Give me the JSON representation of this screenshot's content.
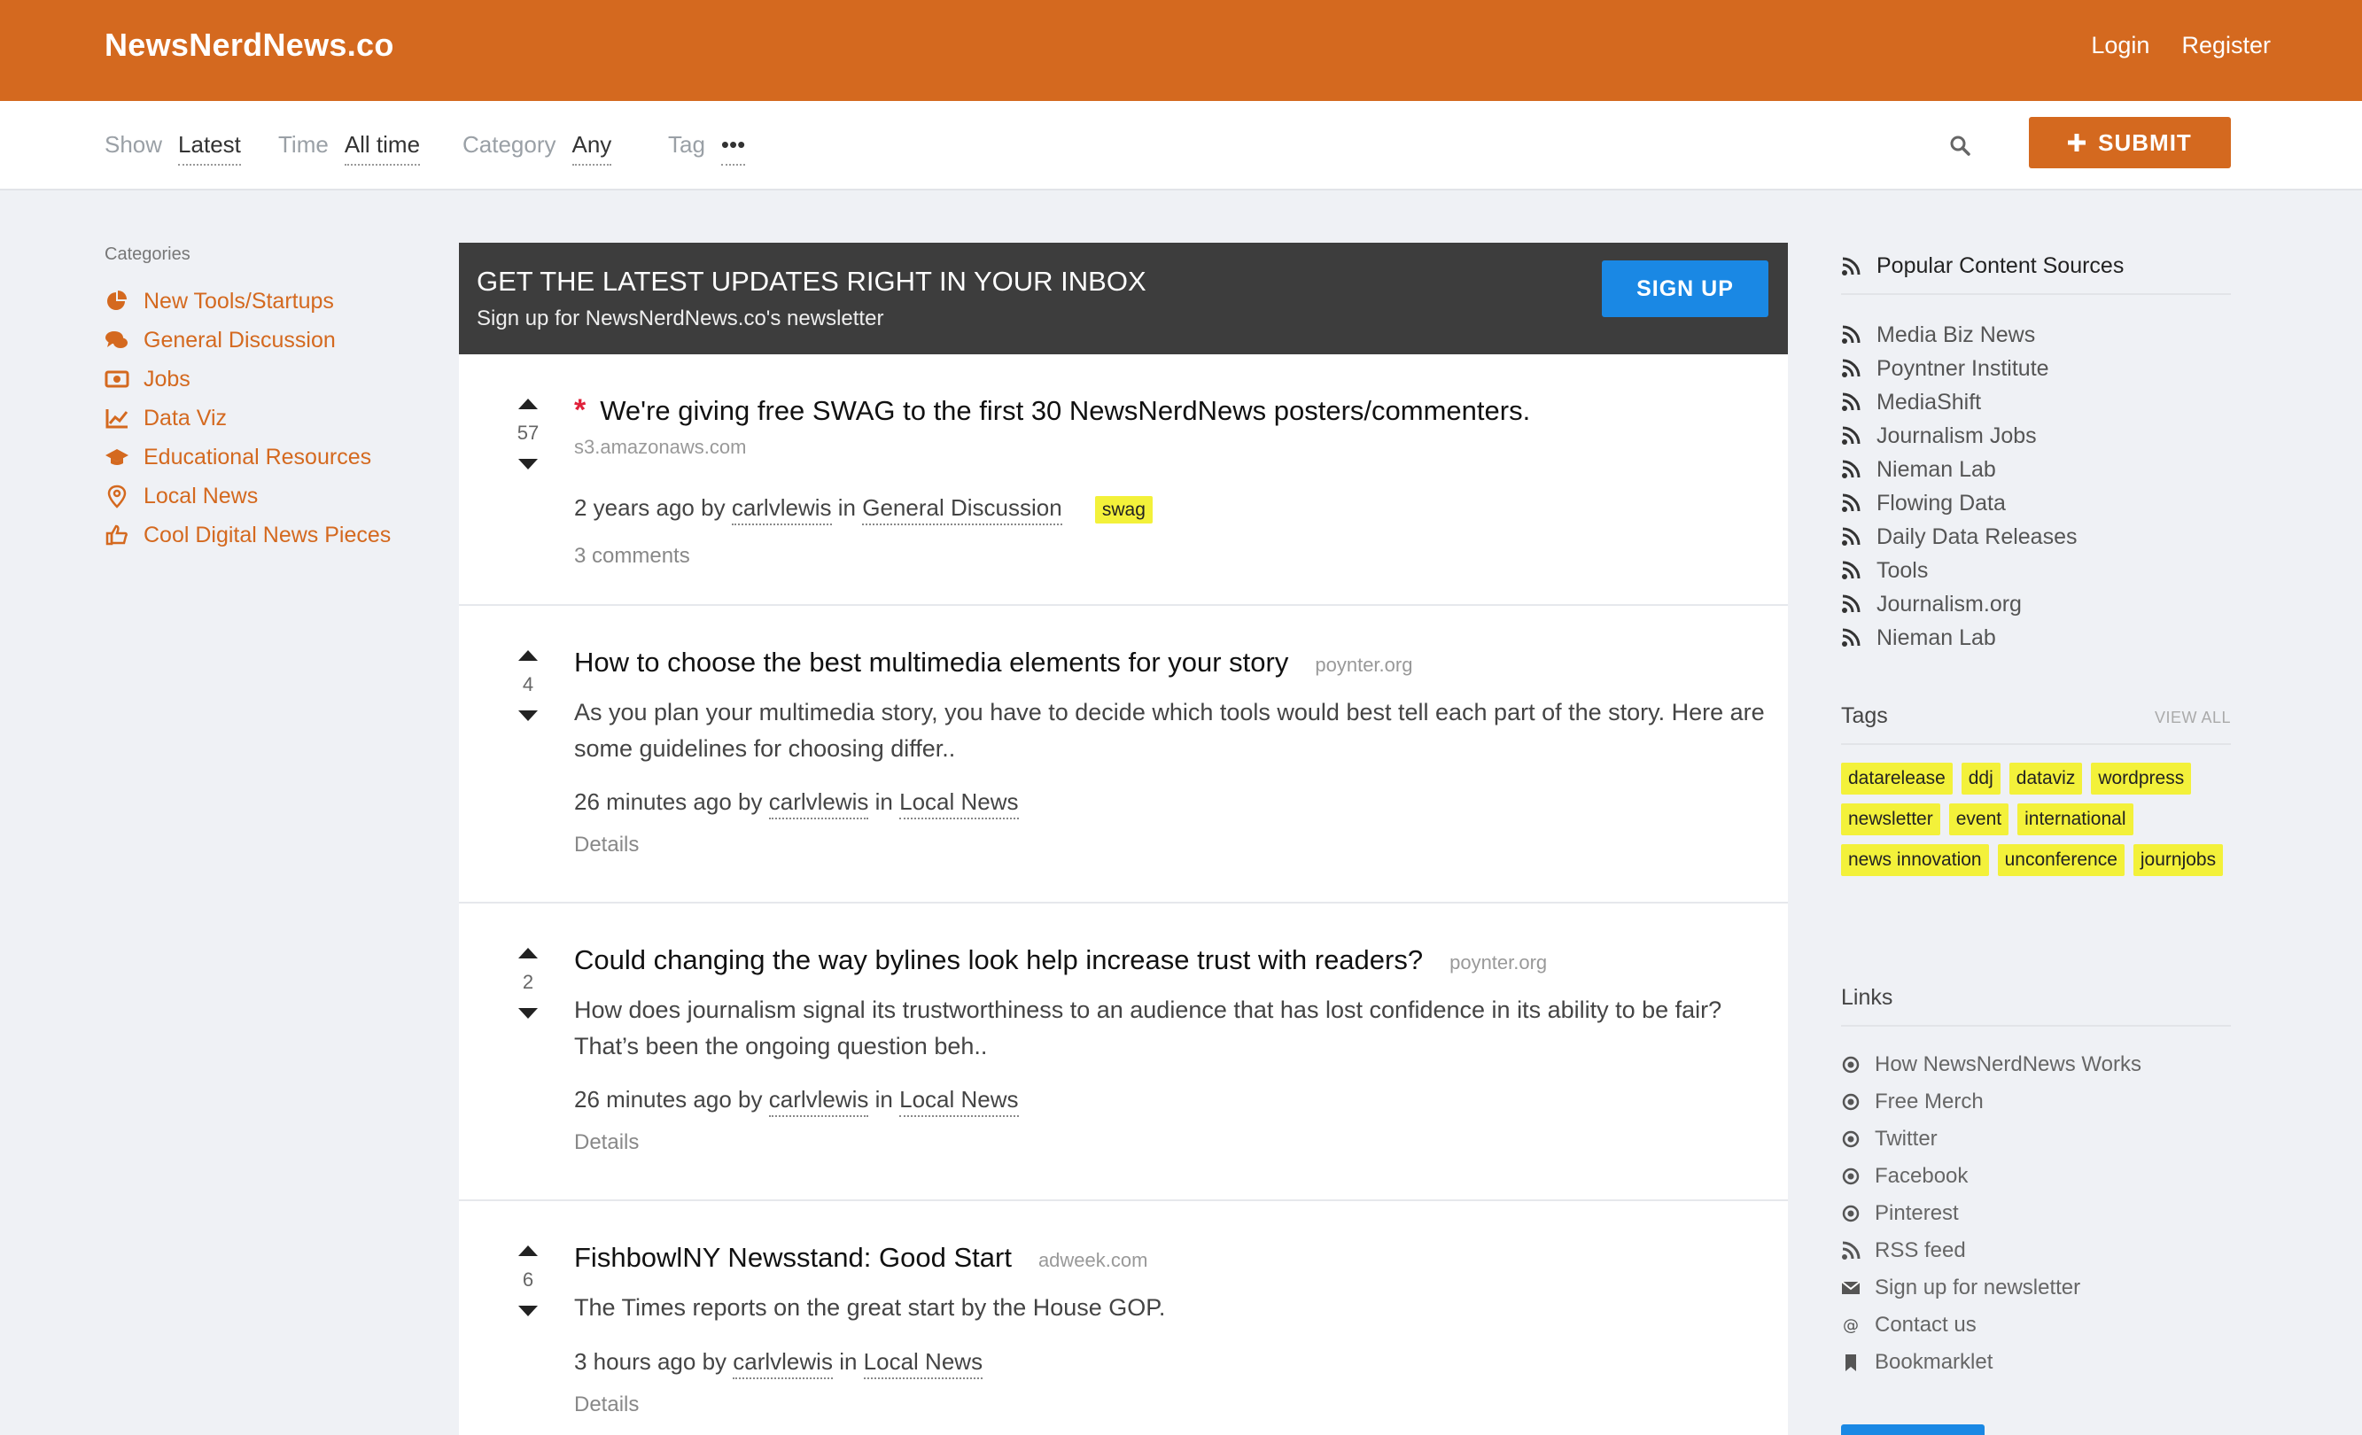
{
  "brand": "NewsNerdNews.co",
  "nav": {
    "login": "Login",
    "register": "Register"
  },
  "filters": [
    {
      "label": "Show",
      "value": "Latest"
    },
    {
      "label": "Time",
      "value": "All time"
    },
    {
      "label": "Category",
      "value": "Any"
    },
    {
      "label": "Tag",
      "value": "•••"
    }
  ],
  "submit_label": "SUBMIT",
  "sidebar": {
    "heading": "Categories",
    "items": [
      {
        "label": "New Tools/Startups",
        "icon": "pie-chart-icon"
      },
      {
        "label": "General Discussion",
        "icon": "comments-icon"
      },
      {
        "label": "Jobs",
        "icon": "money-icon"
      },
      {
        "label": "Data Viz",
        "icon": "line-chart-icon"
      },
      {
        "label": "Educational Resources",
        "icon": "graduation-cap-icon"
      },
      {
        "label": "Local News",
        "icon": "map-pin-icon"
      },
      {
        "label": "Cool Digital News Pieces",
        "icon": "thumbs-up-icon"
      }
    ]
  },
  "newsletter": {
    "title": "GET THE LATEST UPDATES RIGHT IN YOUR INBOX",
    "subtitle": "Sign up for NewsNerdNews.co's newsletter",
    "button": "SIGN UP"
  },
  "posts": [
    {
      "votes": "57",
      "title": "We're giving free SWAG to the first 30 NewsNerdNews posters/commenters.",
      "domain": "s3.amazonaws.com",
      "time": "2 years ago",
      "by": "by",
      "author": "carlvlewis",
      "in": "in",
      "category": "General Discussion",
      "tag": "swag",
      "footer": "3 comments"
    },
    {
      "votes": "4",
      "title": "How to choose the best multimedia elements for your story",
      "domain": "poynter.org",
      "excerpt": "As you plan your multimedia story, you have to decide which tools would best tell each part of the story. Here are some guidelines for choosing differ..",
      "time": "26 minutes ago",
      "by": "by",
      "author": "carlvlewis",
      "in": "in",
      "category": "Local News",
      "footer": "Details"
    },
    {
      "votes": "2",
      "title": "Could changing the way bylines look help increase trust with readers?",
      "domain": "poynter.org",
      "excerpt": "How does journalism signal its trustworthiness to an audience that has lost confidence in its ability to be fair? That’s been the ongoing question beh..",
      "time": "26 minutes ago",
      "by": "by",
      "author": "carlvlewis",
      "in": "in",
      "category": "Local News",
      "footer": "Details"
    },
    {
      "votes": "6",
      "title": "FishbowlNY Newsstand: Good Start",
      "domain": "adweek.com",
      "excerpt": "The Times reports on the great start by the House GOP.",
      "time": "3 hours ago",
      "by": "by",
      "author": "carlvlewis",
      "in": "in",
      "category": "Local News",
      "footer": "Details"
    }
  ],
  "right": {
    "sources_heading": "Popular Content Sources",
    "sources": [
      "Media Biz News",
      "Poyntner Institute",
      "MediaShift",
      "Journalism Jobs",
      "Nieman Lab",
      "Flowing Data",
      "Daily Data Releases",
      "Tools",
      "Journalism.org",
      "Nieman Lab"
    ],
    "tags_heading": "Tags",
    "view_all": "VIEW ALL",
    "tags": [
      "datarelease",
      "ddj",
      "dataviz",
      "wordpress",
      "newsletter",
      "event",
      "international",
      "news innovation",
      "unconference",
      "journjobs"
    ],
    "links_heading": "Links",
    "links": [
      {
        "label": "How NewsNerdNews Works",
        "icon": "circle-dot-icon"
      },
      {
        "label": "Free Merch",
        "icon": "circle-dot-icon"
      },
      {
        "label": "Twitter",
        "icon": "circle-dot-icon"
      },
      {
        "label": "Facebook",
        "icon": "circle-dot-icon"
      },
      {
        "label": "Pinterest",
        "icon": "circle-dot-icon"
      },
      {
        "label": "RSS feed",
        "icon": "rss-icon"
      },
      {
        "label": "Sign up for newsletter",
        "icon": "envelope-icon"
      },
      {
        "label": "Contact us",
        "icon": "at-icon"
      },
      {
        "label": "Bookmarklet",
        "icon": "bookmark-icon"
      }
    ]
  },
  "colors": {
    "brand": "#d4691f",
    "accent_blue": "#1a88e4",
    "tag_yellow": "#f3f13a",
    "newsletter_bg": "#3d3d3d"
  }
}
